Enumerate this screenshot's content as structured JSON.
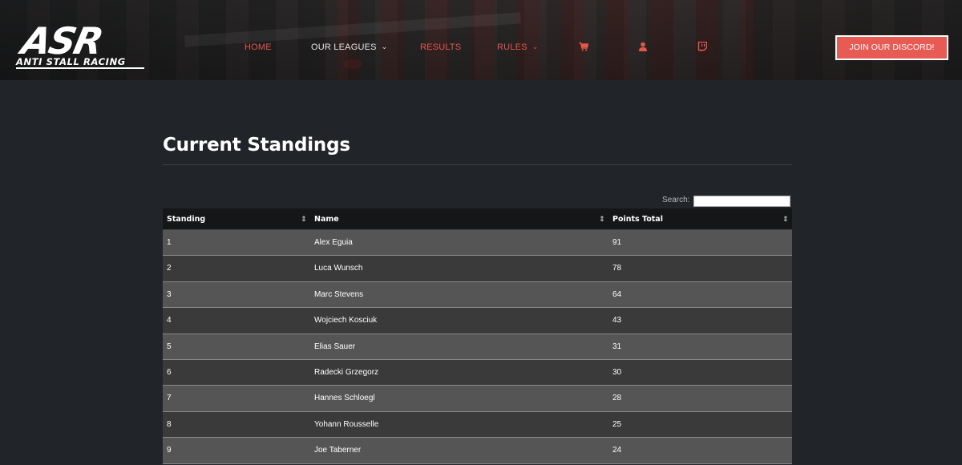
{
  "logo": {
    "letters": "ASR",
    "subtitle": "ANTI STALL RACING"
  },
  "nav": {
    "home": "HOME",
    "leagues": "OUR LEAGUES",
    "results": "RESULTS",
    "rules": "RULES",
    "icons": [
      "cart-icon",
      "user-icon",
      "twitch-icon"
    ]
  },
  "discord_button": "JOIN OUR DISCORD!",
  "colors": {
    "accent": "#e85b55",
    "nav_active": "#e2574c",
    "background": "#212529",
    "row_odd": "#555555",
    "row_even": "#3a3a3a"
  },
  "page_title": "Current Standings",
  "search": {
    "label": "Search:",
    "value": ""
  },
  "table": {
    "headers": [
      "Standing",
      "Name",
      "Points Total"
    ],
    "rows": [
      [
        "1",
        "Alex Eguia",
        "91"
      ],
      [
        "2",
        "Luca Wunsch",
        "78"
      ],
      [
        "3",
        "Marc Stevens",
        "64"
      ],
      [
        "4",
        "Wojciech Kosciuk",
        "43"
      ],
      [
        "5",
        "Elias Sauer",
        "31"
      ],
      [
        "6",
        "Radecki Grzegorz",
        "30"
      ],
      [
        "7",
        "Hannes Schloegl",
        "28"
      ],
      [
        "8",
        "Yohann Rousselle",
        "25"
      ],
      [
        "9",
        "Joe Taberner",
        "24"
      ]
    ]
  }
}
